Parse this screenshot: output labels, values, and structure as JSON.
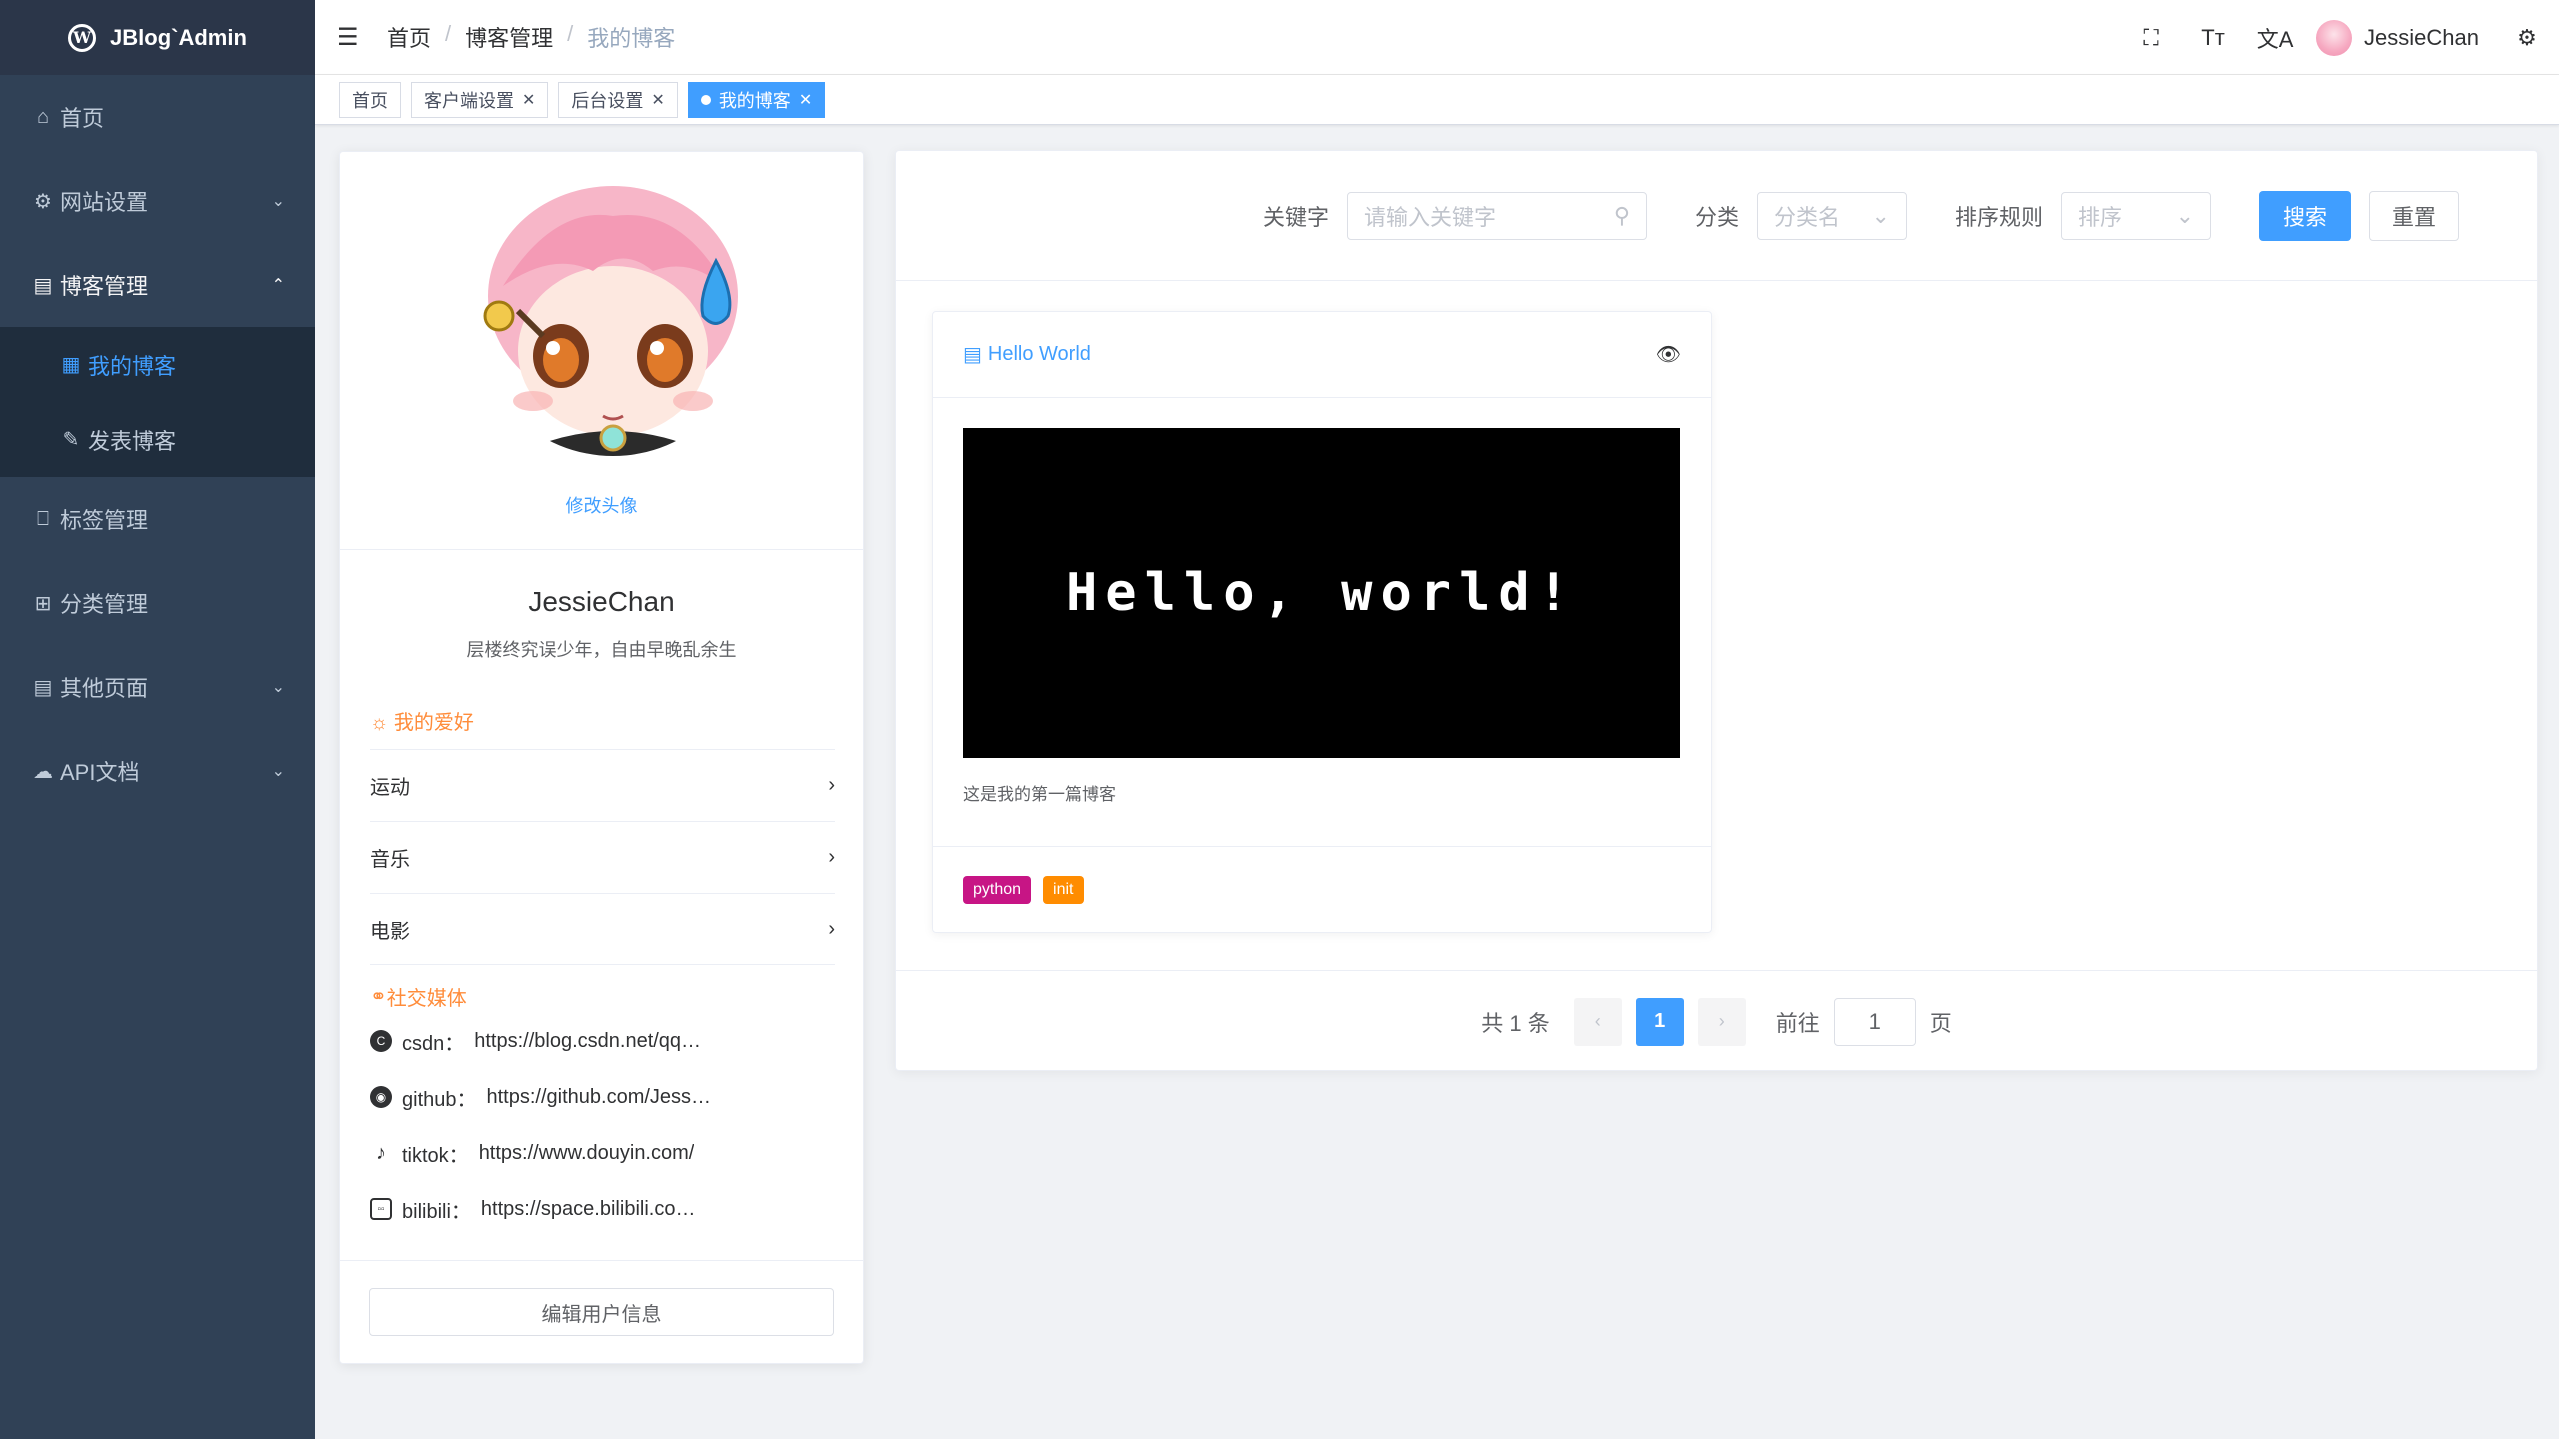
{
  "sidebar": {
    "logo": "JBlog`Admin",
    "items": [
      {
        "label": "首页"
      },
      {
        "label": "网站设置"
      },
      {
        "label": "博客管理"
      },
      {
        "label": "我的博客"
      },
      {
        "label": "发表博客"
      },
      {
        "label": "标签管理"
      },
      {
        "label": "分类管理"
      },
      {
        "label": "其他页面"
      },
      {
        "label": "API文档"
      }
    ]
  },
  "header": {
    "breadcrumb": [
      "首页",
      "博客管理",
      "我的博客"
    ],
    "username": "JessieChan"
  },
  "tags": [
    {
      "label": "首页"
    },
    {
      "label": "客户端设置"
    },
    {
      "label": "后台设置"
    },
    {
      "label": "我的博客"
    }
  ],
  "profile": {
    "change_avatar": "修改头像",
    "name": "JessieChan",
    "signature": "层楼终究误少年，自由早晚乱余生",
    "hobby_title": "我的爱好",
    "hobbies": [
      "运动",
      "音乐",
      "电影"
    ],
    "social_title": "社交媒体",
    "social": [
      {
        "name": "csdn：",
        "url": "https://blog.csdn.net/qq…"
      },
      {
        "name": "github：",
        "url": "https://github.com/Jess…"
      },
      {
        "name": "tiktok：",
        "url": "https://www.douyin.com/"
      },
      {
        "name": "bilibili：",
        "url": "https://space.bilibili.co…"
      }
    ],
    "edit_button": "编辑用户信息"
  },
  "search": {
    "keyword_label": "关键字",
    "keyword_placeholder": "请输入关键字",
    "category_label": "分类",
    "category_placeholder": "分类名",
    "sort_label": "排序规则",
    "sort_placeholder": "排序",
    "search_button": "搜索",
    "reset_button": "重置"
  },
  "blog": {
    "title": "Hello World",
    "image_text": "Hello, world!",
    "description": "这是我的第一篇博客",
    "tags": [
      {
        "label": "python",
        "color": "#c71585"
      },
      {
        "label": "init",
        "color": "#ff8c00"
      }
    ]
  },
  "pagination": {
    "total": "共 1 条",
    "current": "1",
    "goto_label": "前往",
    "goto_value": "1",
    "page_suffix": "页"
  },
  "colors": {
    "sidebar_bg": "#304156",
    "primary": "#409eff",
    "accent_orange": "#ff8c3a"
  }
}
